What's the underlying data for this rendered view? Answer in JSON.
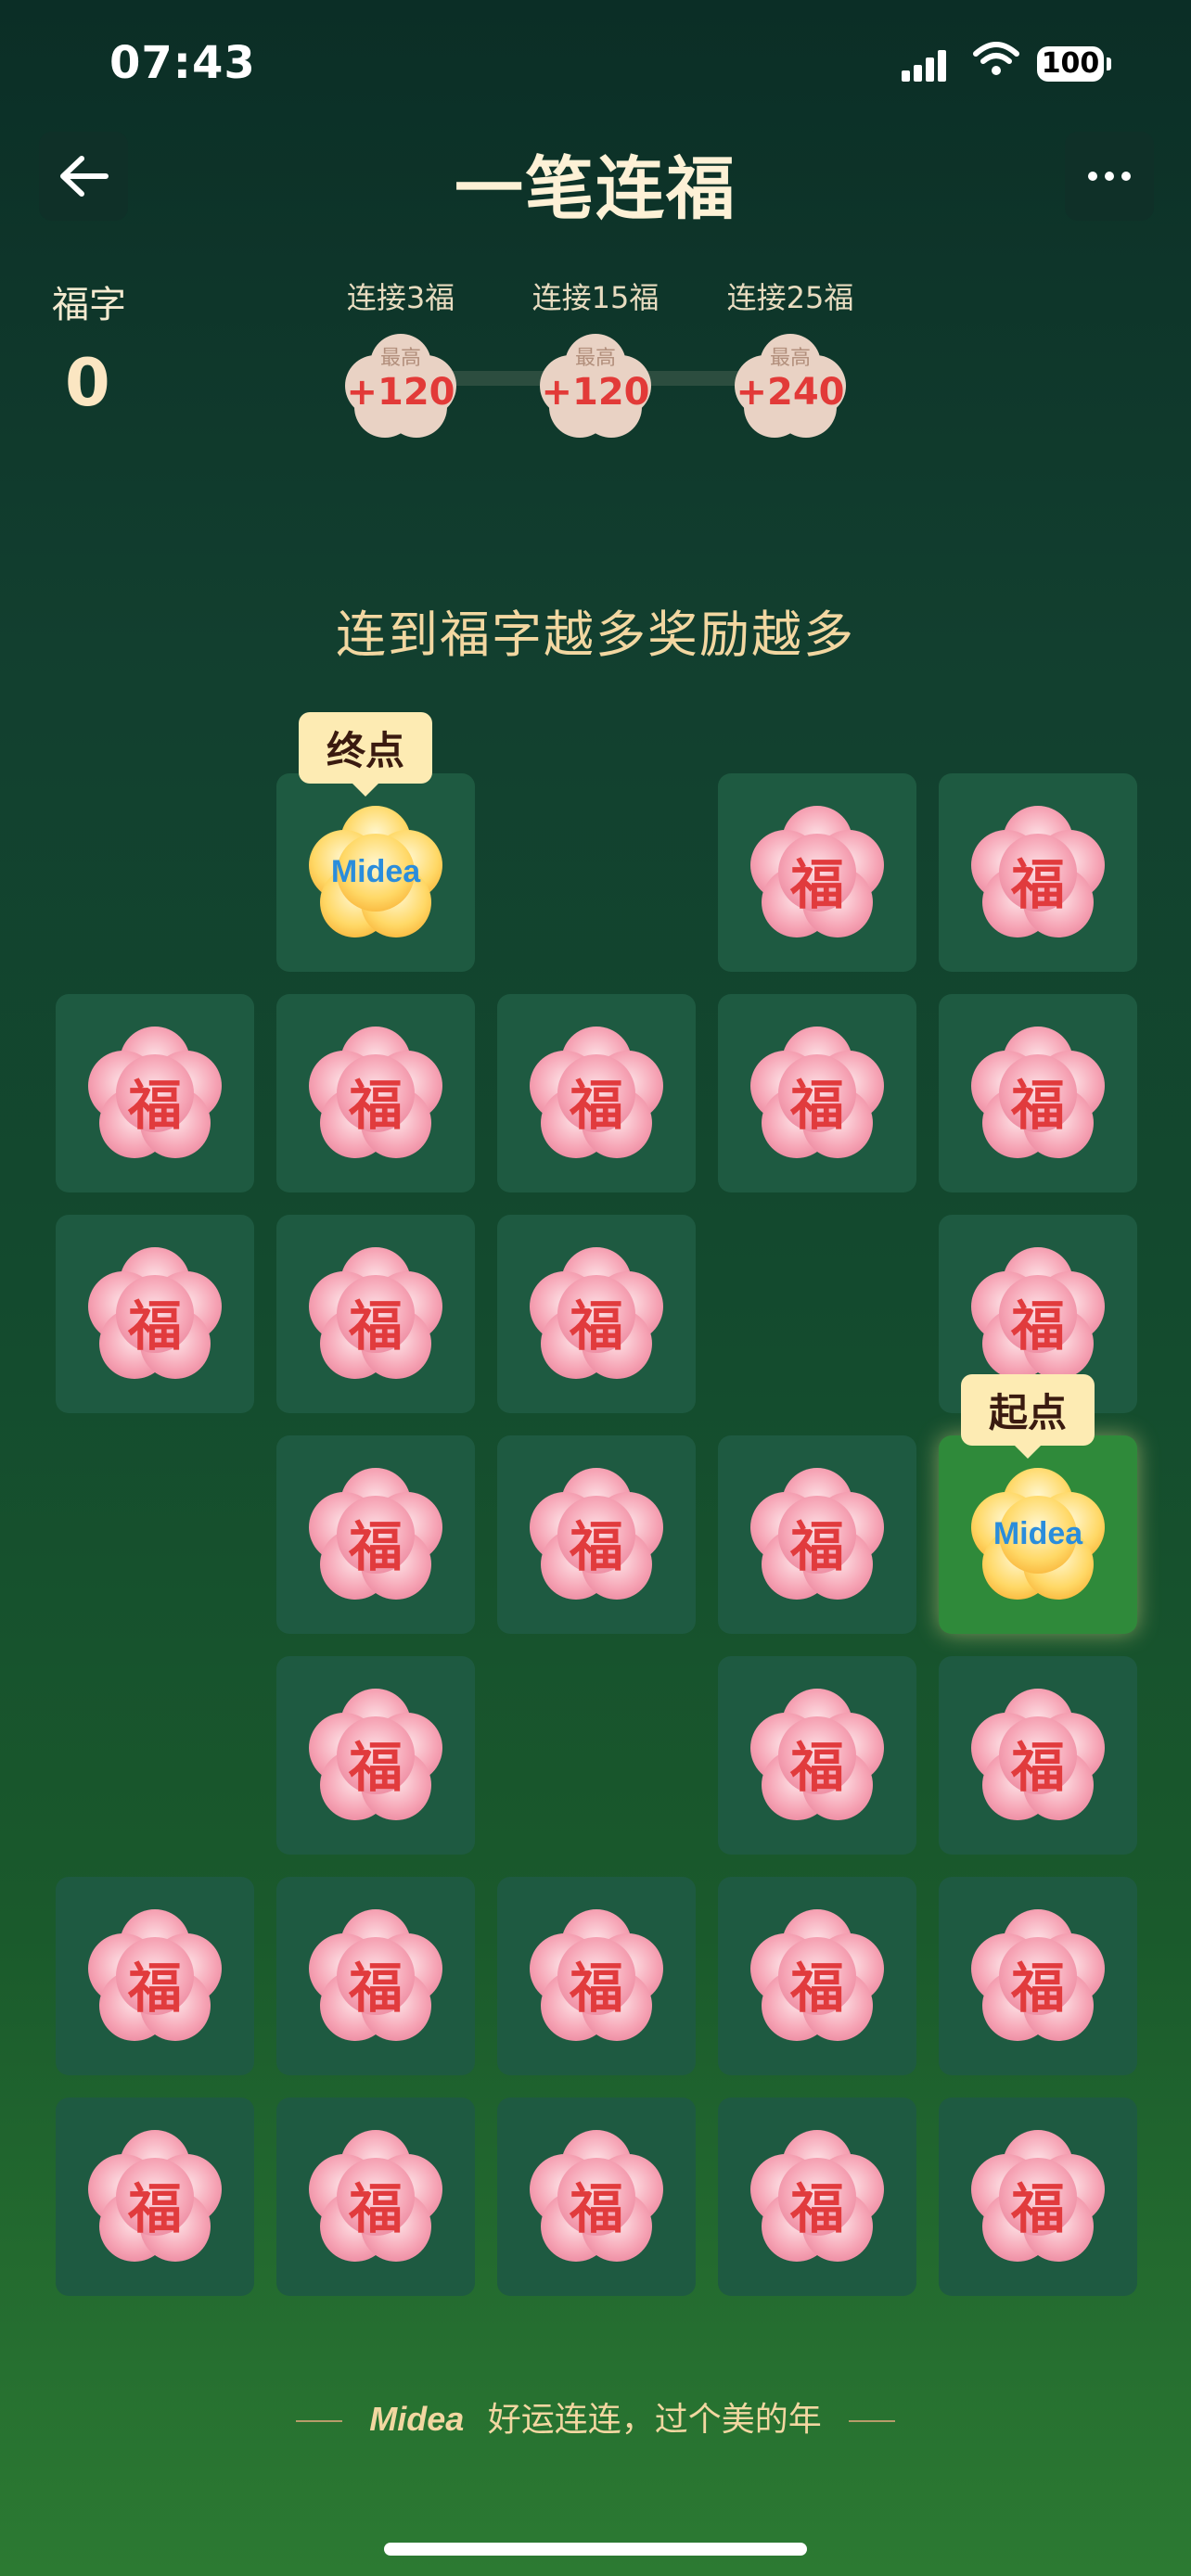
{
  "status": {
    "time": "07:43",
    "battery": "100"
  },
  "header": {
    "title": "一笔连福"
  },
  "score": {
    "label": "福字",
    "value": "0"
  },
  "milestones": [
    {
      "label": "连接3福",
      "top": "最高",
      "amount": "+120"
    },
    {
      "label": "连接15福",
      "top": "最高",
      "amount": "+120"
    },
    {
      "label": "连接25福",
      "top": "最高",
      "amount": "+240"
    }
  ],
  "hint": "连到福字越多奖励越多",
  "board": {
    "fu_char": "福",
    "logo": "Midea",
    "end_label": "终点",
    "start_label": "起点"
  },
  "footer": {
    "logo": "Midea",
    "slogan": "好运连连，过个美的年"
  }
}
